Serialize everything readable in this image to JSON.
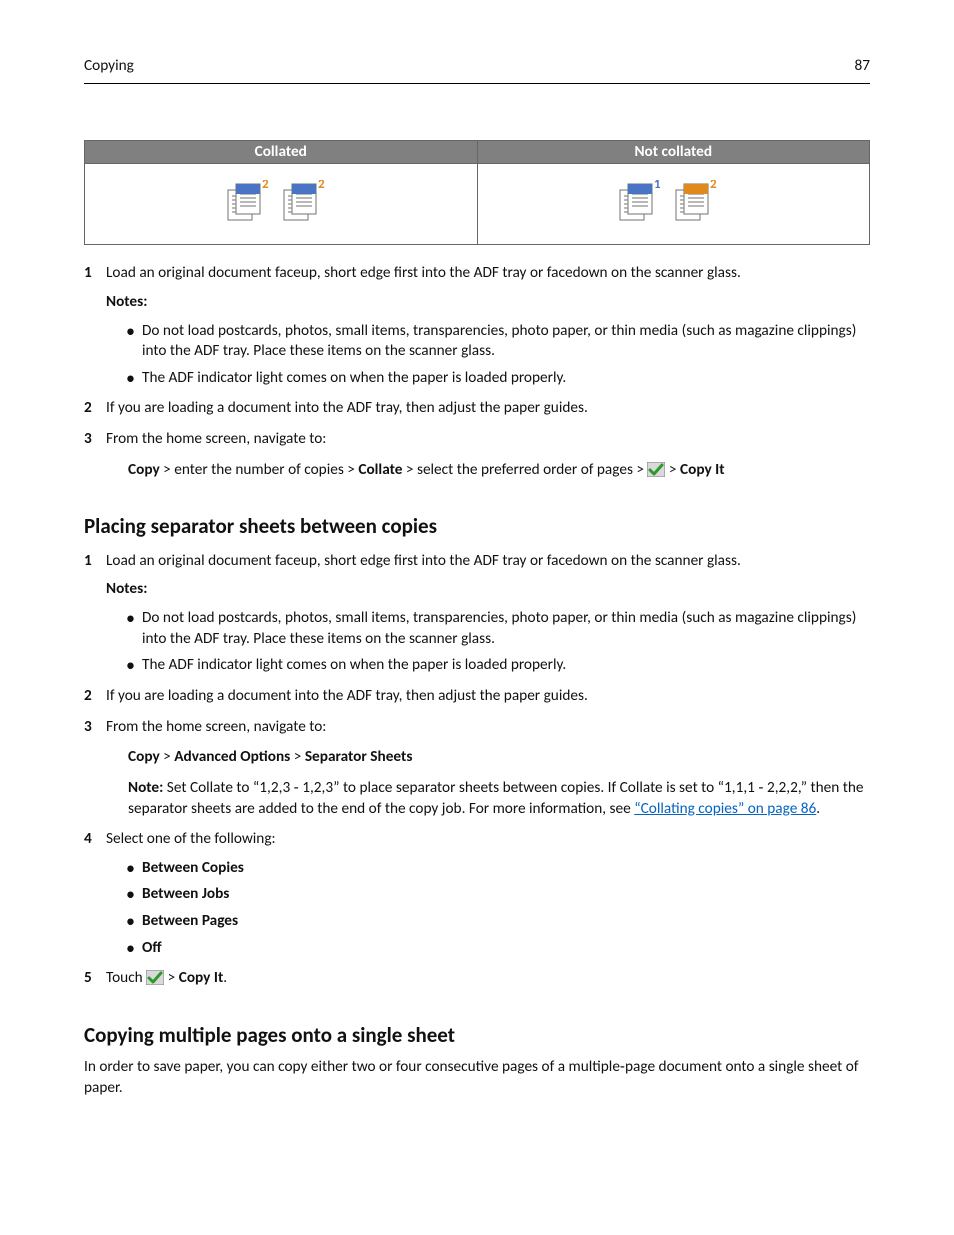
{
  "runhead": {
    "left": "Copying",
    "right": "87"
  },
  "table": {
    "h1": "Collated",
    "h2": "Not collated"
  },
  "sec1": {
    "s1": "Load an original document faceup, short edge first into the ADF tray or facedown on the scanner glass.",
    "notes_label": "Notes:",
    "n1": "Do not load postcards, photos, small items, transparencies, photo paper, or thin media (such as magazine clippings) into the ADF tray. Place these items on the scanner glass.",
    "n2": "The ADF indicator light comes on when the paper is loaded properly.",
    "s2": "If you are loading a document into the ADF tray, then adjust the paper guides.",
    "s3": "From the home screen, navigate to:",
    "nav_copy": "Copy",
    "nav_t1": " > enter the number of copies > ",
    "nav_collate": "Collate",
    "nav_t2": " > select the preferred order of pages > ",
    "nav_copyit": "Copy It"
  },
  "sec2": {
    "title": "Placing separator sheets between copies",
    "s1": "Load an original document faceup, short edge first into the ADF tray or facedown on the scanner glass.",
    "notes_label": "Notes:",
    "n1": "Do not load postcards, photos, small items, transparencies, photo paper, or thin media (such as magazine clippings) into the ADF tray. Place these items on the scanner glass.",
    "n2": "The ADF indicator light comes on when the paper is loaded properly.",
    "s2": "If you are loading a document into the ADF tray, then adjust the paper guides.",
    "s3": "From the home screen, navigate to:",
    "path_copy": "Copy",
    "path_adv": "Advanced Options",
    "path_sep": "Separator Sheets",
    "note2_label": "Note:",
    "note2_a": " Set Collate to “1,2,3 ‑ 1,2,3” to place separator sheets between copies. If Collate is set to “1,1,1 ‑ 2,2,2,” then the separator sheets are added to the end of the copy job. For more information, see ",
    "note2_link": "“Collating copies” on page 86",
    "s4": "Select one of the following:",
    "o1": "Between Copies",
    "o2": "Between Jobs",
    "o3": "Between Pages",
    "o4": "Off",
    "s5a": "Touch ",
    "s5b": "Copy It"
  },
  "sec3": {
    "title": "Copying multiple pages onto a single sheet",
    "p1": "In order to save paper, you can copy either two or four consecutive pages of a multiple‑page document onto a single sheet of paper."
  }
}
